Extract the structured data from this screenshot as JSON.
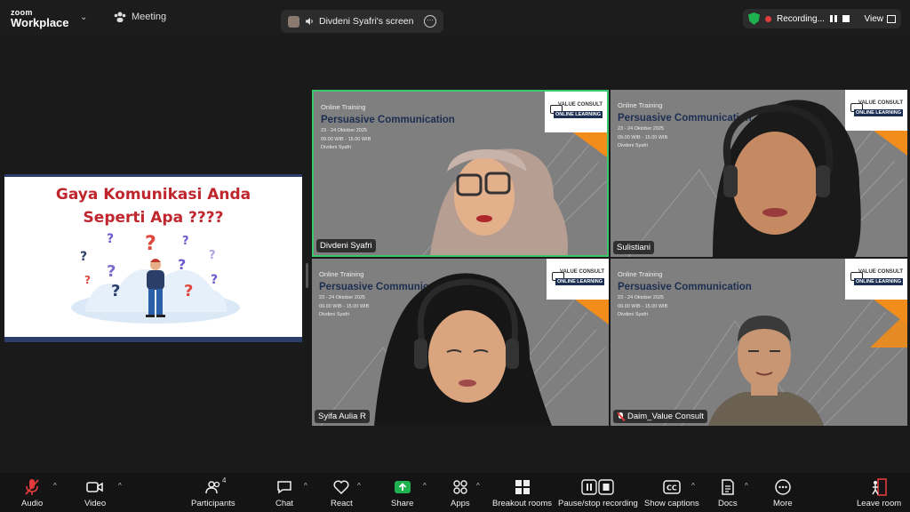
{
  "topbar": {
    "brand_line1": "zoom",
    "brand_line2": "Workplace",
    "meeting_label": "Meeting",
    "share_title": "Divdeni Syafri's screen",
    "recording_label": "Recording...",
    "view_label": "View",
    "colors": {
      "recording": "#e23b3b",
      "encrypted": "#1fb050"
    }
  },
  "slide": {
    "title_line1": "Gaya Komunikasi Anda",
    "title_line2": "Seperti Apa ????",
    "colors": {
      "title": "#c0262d",
      "stripe": "#2b3e69"
    }
  },
  "card": {
    "online_training": "Online Training",
    "course": "Persuasive Communication",
    "date": "23 - 24 Oktober 2025",
    "time": "09.00 WIB - 15.00 WIB",
    "host": "Divdeni Syafri",
    "logo_text": "VALUE CONSULT",
    "logo_sub": "ONLINE LEARNING"
  },
  "participants": [
    {
      "name": "Divdeni Syafri",
      "active_speaker": true,
      "muted": false
    },
    {
      "name": "Sulistiani",
      "active_speaker": false,
      "muted": false
    },
    {
      "name": "Syifa Aulia R",
      "active_speaker": false,
      "muted": false
    },
    {
      "name": "Daim_Value Consult",
      "active_speaker": false,
      "muted": true
    }
  ],
  "toolbar": {
    "audio": "Audio",
    "video": "Video",
    "participants": "Participants",
    "participants_count": "4",
    "chat": "Chat",
    "react": "React",
    "share": "Share",
    "apps": "Apps",
    "breakout": "Breakout rooms",
    "recording": "Pause/stop recording",
    "captions": "Show captions",
    "docs": "Docs",
    "more": "More",
    "leave": "Leave room",
    "colors": {
      "share": "#1fb050",
      "muted": "#e23b3b",
      "leave": "#e23b3b"
    }
  }
}
